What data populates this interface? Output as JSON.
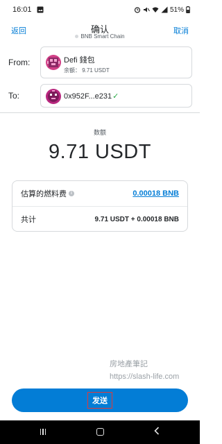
{
  "status_bar": {
    "time": "16:01",
    "battery": "51%"
  },
  "nav": {
    "back_label": "返回",
    "title": "确认",
    "network": "BNB Smart Chain",
    "cancel_label": "取消"
  },
  "from": {
    "label": "From:",
    "account_name": "Defi 錢包",
    "balance": "余额： 9.71 USDT"
  },
  "to": {
    "label": "To:",
    "address": "0x952F...e231"
  },
  "amount": {
    "label": "数额",
    "value": "9.71 USDT"
  },
  "fees": {
    "gas_label": "估算的燃料费",
    "gas_value": "0.00018 BNB",
    "total_label": "共计",
    "total_value": "9.71 USDT + 0.00018 BNB"
  },
  "watermark": {
    "line1": "房地產筆記",
    "line2": "https://slash-life.com"
  },
  "send_button": {
    "label": "发送"
  },
  "colors": {
    "accent": "#037dd6",
    "success": "#28a745",
    "highlight": "#e53935"
  }
}
